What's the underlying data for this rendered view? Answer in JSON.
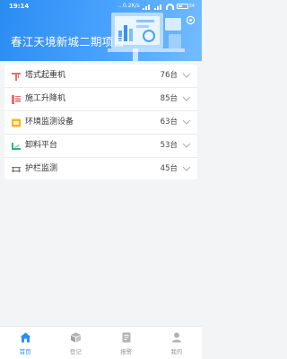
{
  "status_bar": {
    "time": "19:14",
    "network_speed": "...0.2K/s",
    "battery": "34"
  },
  "header": {
    "title": "春江天境新城二期项目"
  },
  "equipment_list": [
    {
      "icon": "tower-crane-icon",
      "label": "塔式起重机",
      "count": "76台"
    },
    {
      "icon": "construction-hoist-icon",
      "label": "施工升降机",
      "count": "85台"
    },
    {
      "icon": "environment-monitor-icon",
      "label": "环境监测设备",
      "count": "63台"
    },
    {
      "icon": "unloading-platform-icon",
      "label": "卸料平台",
      "count": "53台"
    },
    {
      "icon": "guardrail-monitor-icon",
      "label": "护栏监测",
      "count": "45台"
    }
  ],
  "bottom_nav": [
    {
      "icon": "home-icon",
      "label": "首页",
      "active": true
    },
    {
      "icon": "register-icon",
      "label": "登记",
      "active": false
    },
    {
      "icon": "alarm-icon",
      "label": "报警",
      "active": false
    },
    {
      "icon": "profile-icon",
      "label": "我的",
      "active": false
    }
  ],
  "colors": {
    "primary": "#2f8ef4",
    "header_gradient_start": "#2a8cf2",
    "header_gradient_end": "#74bcff",
    "background": "#f3f4f6",
    "inactive_nav": "#999999"
  }
}
